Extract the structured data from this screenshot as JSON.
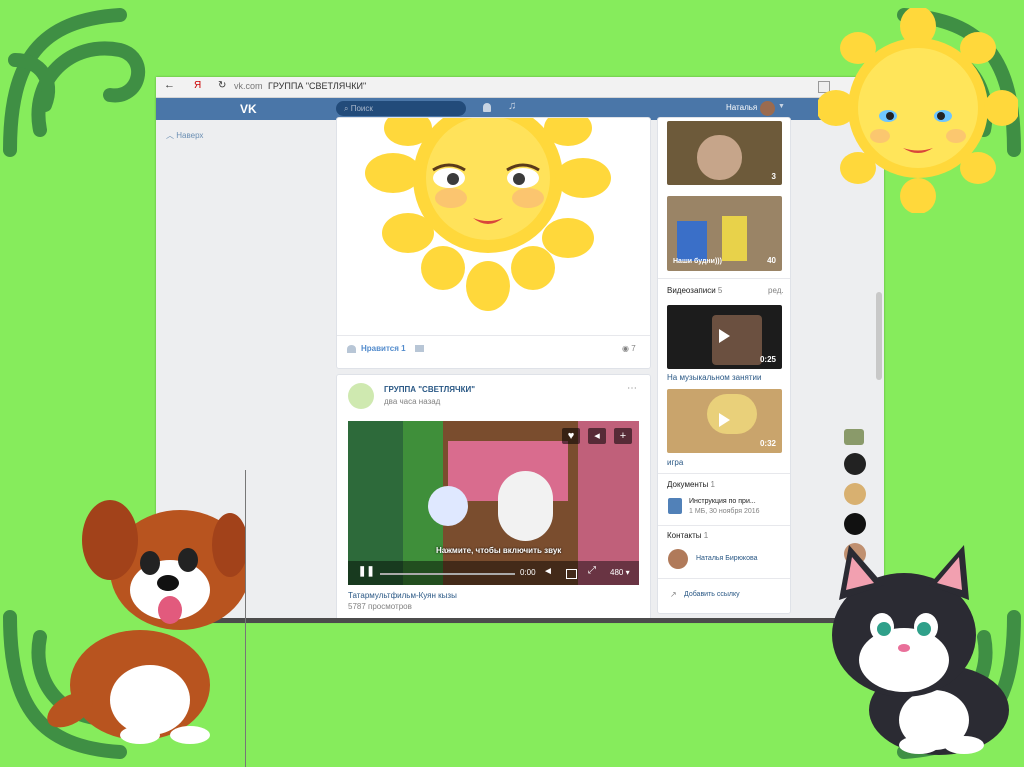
{
  "browser": {
    "back_glyph": "←",
    "yandex_glyph": "Я",
    "reload_glyph": "↻",
    "domain": "vk.com",
    "page_title": "ГРУППА \"СВЕТЛЯЧКИ\""
  },
  "vk_header": {
    "logo": "VK",
    "search_placeholder": "Поиск",
    "user_name": "Наталья"
  },
  "left_nav": {
    "back_to_top": "Наверх"
  },
  "post1": {
    "likes_label": "Нравится",
    "likes_count": "1",
    "views_count": "7"
  },
  "post2": {
    "group_name": "ГРУППА \"СВЕТЛЯЧКИ\"",
    "time": "два часа назад",
    "video_prompt": "Нажмите, чтобы включить звук",
    "time_code": "0:00",
    "quality": "480",
    "video_title": "Татармультфильм-Куян кызы",
    "video_views": "5787 просмотров"
  },
  "right_col": {
    "photo1_count": "3",
    "photo2_caption": "Наши будни)))",
    "photo2_count": "40",
    "videos_header": "Видеозаписи",
    "videos_count": "5",
    "videos_edit": "ред.",
    "video1_duration": "0:25",
    "video1_title": "На музыкальном занятии",
    "video2_duration": "0:32",
    "video2_title": "игра",
    "docs_header": "Документы",
    "docs_count": "1",
    "doc_title": "Инструкция по при...",
    "doc_meta": "1 МБ, 30 ноября 2016",
    "contacts_header": "Контакты",
    "contacts_count": "1",
    "contact_name": "Наталья Бирюкова",
    "add_link": "Добавить ссылку"
  },
  "colors": {
    "background": "#86ec5c",
    "ornament": "#3f8f44",
    "vk_blue": "#4a76a8",
    "sun": "#ffd83b"
  }
}
